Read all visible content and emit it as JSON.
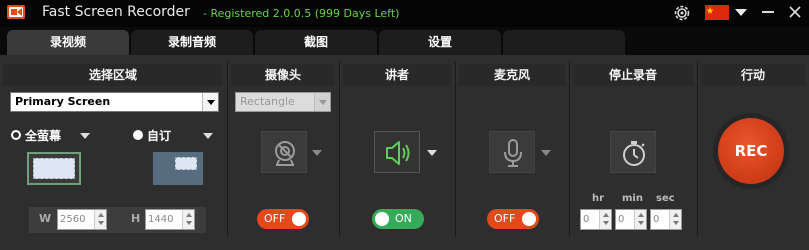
{
  "titlebar": {
    "app_title": "Fast Screen Recorder",
    "registration": "- Registered 2.0.0.5 (999 Days Left)"
  },
  "tabs": [
    {
      "label": "录视频",
      "active": true
    },
    {
      "label": "录制音频",
      "active": false
    },
    {
      "label": "截图",
      "active": false
    },
    {
      "label": "设置",
      "active": false
    }
  ],
  "area": {
    "heading": "选择区域",
    "screen_select": "Primary Screen",
    "full_screen_label": "全萤幕",
    "full_screen_selected": false,
    "custom_label": "自订",
    "custom_selected": true,
    "width_label": "W",
    "width_value": "2560",
    "height_label": "H",
    "height_value": "1440"
  },
  "camera": {
    "heading": "摄像头",
    "select": "Rectangle",
    "toggle": "OFF"
  },
  "speaker": {
    "heading": "讲者",
    "toggle": "ON"
  },
  "microphone": {
    "heading": "麦克风",
    "toggle": "OFF"
  },
  "stop": {
    "heading": "停止录音",
    "hr_label": "hr",
    "min_label": "min",
    "sec_label": "sec",
    "hr_value": "0",
    "min_value": "0",
    "sec_value": "0"
  },
  "action": {
    "heading": "行动",
    "rec_label": "REC"
  },
  "colors": {
    "accent_green": "#6cd04a",
    "toggle_off": "#e4491c",
    "toggle_on": "#35ab5a",
    "rec_red": "#d5421c"
  }
}
